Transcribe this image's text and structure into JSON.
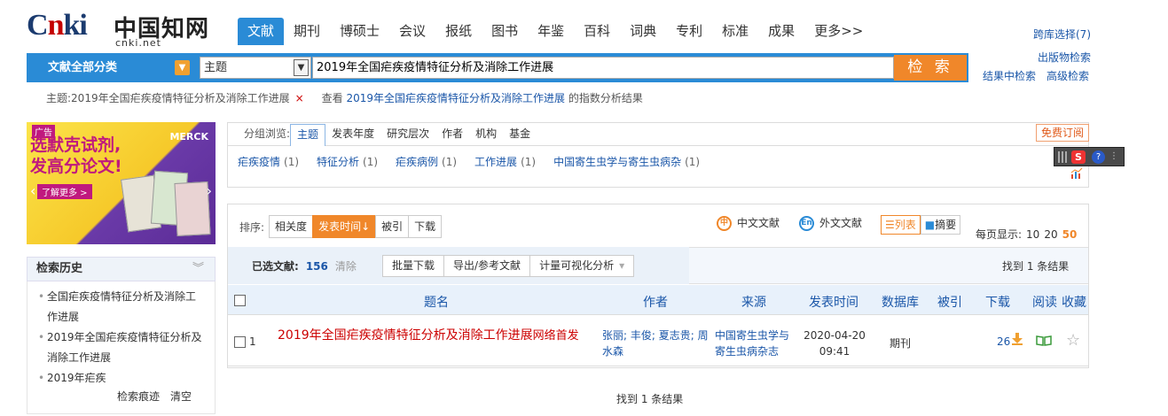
{
  "logo": {
    "cn": "Cnki",
    "zh": "中国知网",
    "url": "cnki.net"
  },
  "topnav": [
    "文献",
    "期刊",
    "博硕士",
    "会议",
    "报纸",
    "图书",
    "年鉴",
    "百科",
    "词典",
    "专利",
    "标准",
    "成果",
    "更多>>"
  ],
  "toplinks": {
    "cross": "跨库选择(7)",
    "publisher": "出版物检索"
  },
  "search": {
    "category": "文献全部分类",
    "field": "主题",
    "query": "2019年全国疟疾疫情特征分析及消除工作进展",
    "button": "检 索",
    "within": "结果中检索",
    "advanced": "高级检索"
  },
  "subject": {
    "label": "主题:2019年全国疟疾疫情特征分析及消除工作进展",
    "close": "×",
    "see": "查看",
    "link": "2019年全国疟疾疫情特征分析及消除工作进展",
    "tail": "的指数分析结果"
  },
  "ad": {
    "tag": "广告",
    "title1": "选默克试剂,",
    "title2": "发高分论文!",
    "brand": "MERCK",
    "more": "了解更多 >"
  },
  "history": {
    "title": "检索历史",
    "items": [
      "全国疟疾疫情特征分析及消除工作进展",
      "2019年全国疟疾疫情特征分析及消除工作进展",
      "2019年疟疾"
    ],
    "trace": "检索痕迹",
    "clear": "清空"
  },
  "group": {
    "label": "分组浏览:",
    "tabs": [
      "主题",
      "发表年度",
      "研究层次",
      "作者",
      "机构",
      "基金"
    ],
    "subscribe": "免费订阅",
    "items": [
      {
        "name": "疟疾疫情",
        "count": "(1)"
      },
      {
        "name": "特征分析",
        "count": "(1)"
      },
      {
        "name": "疟疾病例",
        "count": "(1)"
      },
      {
        "name": "工作进展",
        "count": "(1)"
      },
      {
        "name": "中国寄生虫学与寄生虫病杂",
        "count": "(1)"
      }
    ]
  },
  "sort": {
    "label": "排序:",
    "options": [
      "相关度",
      "发表时间",
      "被引",
      "下载"
    ]
  },
  "lang": {
    "cn": "中文文献",
    "en": "外文文献"
  },
  "view": {
    "list": "列表",
    "abstract": "摘要"
  },
  "perpage": {
    "label": "每页显示:",
    "options": [
      "10",
      "20",
      "50"
    ]
  },
  "selection": {
    "label": "已选文献:",
    "count": "156",
    "clear": "清除",
    "batch": "批量下载",
    "export": "导出/参考文献",
    "viz": "计量可视化分析"
  },
  "found": "找到 1 条结果",
  "table": {
    "headers": [
      "题名",
      "作者",
      "来源",
      "发表时间",
      "数据库",
      "被引",
      "下载",
      "阅读",
      "收藏"
    ]
  },
  "row": {
    "index": "1",
    "title": "2019年全国疟疾疫情特征分析及消除工作进展",
    "pub": "网络首发",
    "authors": "张丽; 丰俊; 夏志贵; 周水森",
    "source": "中国寄生虫学与寄生虫病杂志",
    "date": "2020-04-20",
    "time": "09:41",
    "db": "期刊",
    "downloads": "26"
  }
}
